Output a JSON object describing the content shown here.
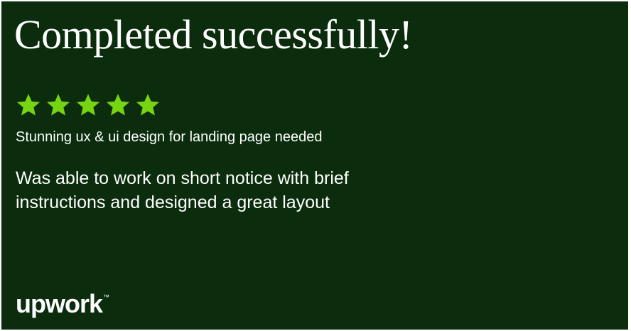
{
  "card": {
    "headline": "Completed successfully!",
    "rating": {
      "value": 5,
      "max": 5,
      "star_color": "#76d412"
    },
    "job_title": "Stunning ux & ui design for landing page needed",
    "review_text": "Was able to work on short notice with brief instructions and designed a great layout",
    "brand": {
      "name": "upwork",
      "trademark": "™"
    },
    "colors": {
      "background": "#0b2d0d",
      "text": "#ffffff"
    }
  }
}
